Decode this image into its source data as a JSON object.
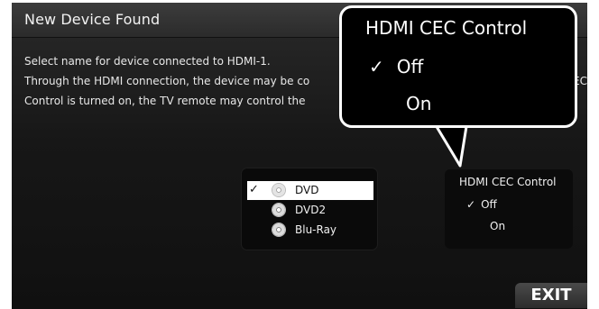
{
  "dialog": {
    "title": "New Device Found",
    "line1": "Select name for device connected to HDMI-1.",
    "line2": "Through the HDMI connection, the device may be co",
    "line2_tail": "EC",
    "line3": "Control is turned on, the TV remote may control the"
  },
  "device_list": {
    "items": [
      {
        "label": "DVD",
        "selected": true,
        "check": "✓"
      },
      {
        "label": "DVD2",
        "selected": false
      },
      {
        "label": "Blu-Ray",
        "selected": false
      }
    ]
  },
  "cec_panel": {
    "title": "HDMI CEC Control",
    "options": [
      {
        "label": "Off",
        "check": "✓"
      },
      {
        "label": "On"
      }
    ]
  },
  "callout": {
    "title": "HDMI CEC Control",
    "options": [
      {
        "label": "Off",
        "check": "✓"
      },
      {
        "label": "On"
      }
    ]
  },
  "footer": {
    "exit_label": "EXIT"
  }
}
